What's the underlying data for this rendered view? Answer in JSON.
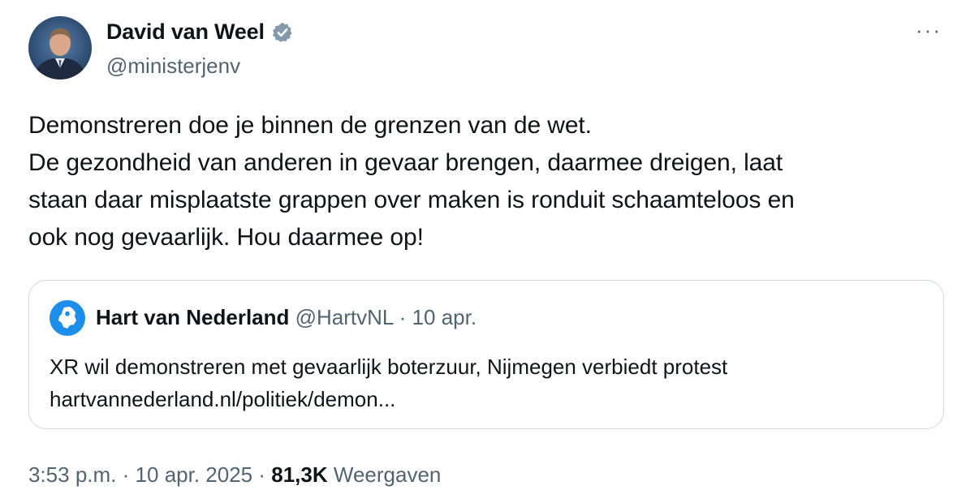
{
  "author": {
    "name": "David van Weel",
    "handle": "@ministerjenv",
    "verified": true,
    "avatar_icon": "person-avatar"
  },
  "more_icon": "more-horizontal-icon",
  "tweet": {
    "lines": [
      "Demonstreren doe je binnen de grenzen van de wet.",
      "De gezondheid van anderen in gevaar brengen, daarmee dreigen, laat",
      "staan daar misplaatste grappen over maken is ronduit schaamteloos en",
      "ook nog gevaarlijk. Hou daarmee op!"
    ]
  },
  "quoted": {
    "name": "Hart van Nederland",
    "handle": "@HartvNL",
    "separator": "·",
    "date": "10 apr.",
    "avatar_icon": "netherlands-map-logo-icon",
    "text": "XR wil demonstreren met gevaarlijk boterzuur, Nijmegen verbiedt protest",
    "link": "hartvannederland.nl/politiek/demon..."
  },
  "meta": {
    "time": "3:53 p.m.",
    "sep1": "·",
    "date": "10 apr. 2025",
    "sep2": "·",
    "views_count": "81,3K",
    "views_label": "Weergaven"
  },
  "colors": {
    "text": "#0f1419",
    "secondary": "#536471",
    "border": "#cfd9de",
    "verified_badge": "#829aab",
    "quoted_logo": "#1d8ee9"
  }
}
